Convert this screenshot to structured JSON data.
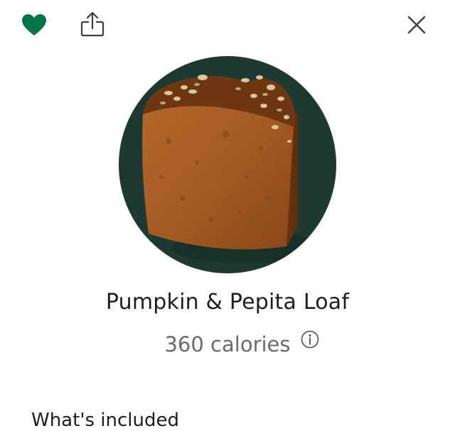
{
  "header": {
    "favorite_icon": "heart-icon",
    "favorite_color": "#00754a",
    "share_icon": "share-icon",
    "close_icon": "close-icon"
  },
  "product": {
    "name": "Pumpkin & Pepita Loaf",
    "calories": "360 calories",
    "info_icon": "info-icon",
    "image_background": "#1e3932"
  },
  "section": {
    "partial_heading": "What's included"
  }
}
